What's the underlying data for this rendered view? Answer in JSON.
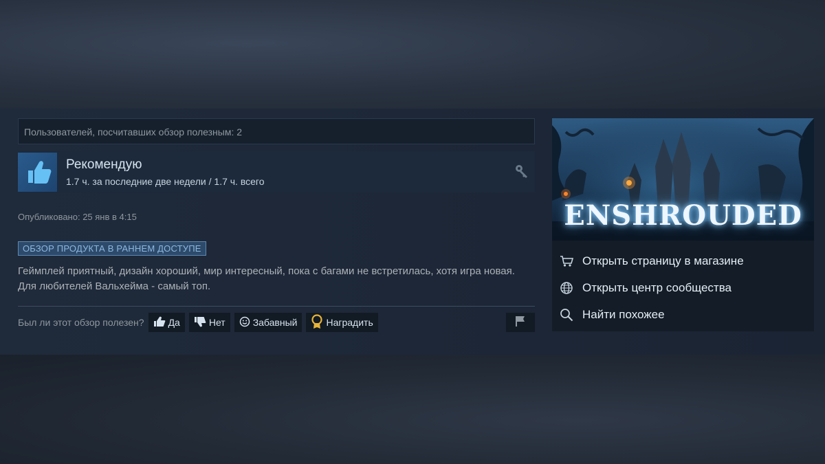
{
  "review": {
    "helpful_count_text": "Пользователей, посчитавших обзор полезным: 2",
    "recommendation": "Рекомендую",
    "hours": "1.7 ч. за последние две недели / 1.7 ч. всего",
    "posted": "Опубликовано: 25 янв в 4:15",
    "early_access_badge": "ОБЗОР ПРОДУКТА В РАННЕМ ДОСТУПЕ",
    "body": "Геймплей приятный, дизайн хороший, мир интересный, пока с багами не встретилась, хотя игра новая. Для любителей Вальхейма - самый топ.",
    "vote_question": "Был ли этот обзор полезен?",
    "vote_yes": "Да",
    "vote_no": "Нет",
    "vote_funny": "Забавный",
    "award": "Наградить"
  },
  "game": {
    "cover_title": "ENSHROUDED",
    "links": [
      {
        "label": "Открыть страницу в магазине",
        "icon": "cart-icon"
      },
      {
        "label": "Открыть центр сообщества",
        "icon": "globe-icon"
      },
      {
        "label": "Найти похожее",
        "icon": "search-icon"
      }
    ]
  },
  "colors": {
    "accent_blue": "#2a5b8c",
    "badge_text": "#8cb8de",
    "award_gold": "#e8b339"
  }
}
